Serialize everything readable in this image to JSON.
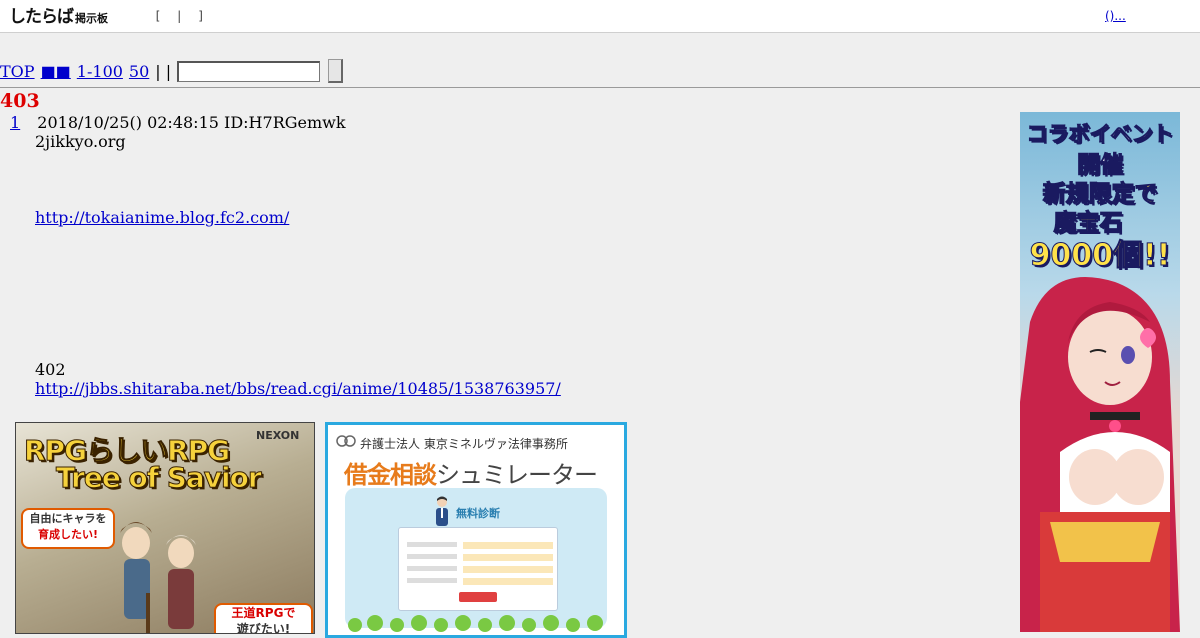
{
  "header": {
    "logo_main": "したらば",
    "logo_sub": "掲示板",
    "brackets": "[  |  ]",
    "right_link": "()..."
  },
  "nav": {
    "top_link": "TOP",
    "board_link": "■■",
    "range_link": "1-100",
    "last50_link": "50",
    "separators": "| |",
    "search_value": "",
    "button_label": ""
  },
  "thread": {
    "title": "403",
    "post_number": "1",
    "post_meta": "2018/10/25() 02:48:15 ID:H7RGemwk",
    "body_line1": "2jikkyo.org",
    "link1": "http://tokaianime.blog.fc2.com/",
    "body_line2": "402",
    "link2": "http://jbbs.shitaraba.net/bbs/read.cgi/anime/10485/1538763957/"
  },
  "ads": {
    "ad1": {
      "title": "RPGらしいRPG",
      "subtitle": "Tree of Savior",
      "brand": "NEXON",
      "bubble1_line1": "自由にキャラを",
      "bubble1_line2": "育成したい!",
      "bubble2_line1": "王道RPGで",
      "bubble2_line2": "遊びたい!"
    },
    "ad2": {
      "org": "弁護士法人 東京ミネルヴァ法律事務所",
      "title_a": "借金相談",
      "title_b": "シュミレーター",
      "diag_label": "無料診断"
    },
    "ad3": {
      "line1": "コラボイベント",
      "line2": "開催",
      "line3": "新規限定で",
      "line4": "魔宝石",
      "line5": "9000個!!"
    }
  },
  "colors": {
    "page_bg": "#efefef",
    "link": "#0000cc",
    "title_red": "#dd0000",
    "ad2_border": "#2aa9e0"
  }
}
